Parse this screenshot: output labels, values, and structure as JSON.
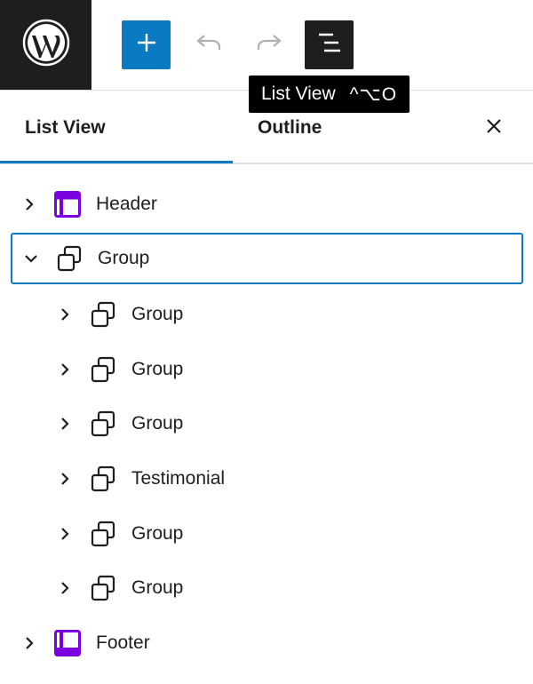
{
  "toolbar": {
    "logo_icon": "wordpress-logo-icon",
    "add_icon": "plus-icon",
    "undo_icon": "undo-icon",
    "redo_icon": "redo-icon",
    "listview_icon": "list-view-icon",
    "accent_color": "#0a7bc2"
  },
  "tooltip": {
    "label": "List View",
    "shortcut": "^⌥O"
  },
  "tabs": [
    {
      "label": "List View",
      "active": true
    },
    {
      "label": "Outline",
      "active": false
    }
  ],
  "close_icon": "close-icon",
  "tree": {
    "items": [
      {
        "label": "Header",
        "icon": "template-part-header-icon",
        "expanded": false,
        "level": 1
      },
      {
        "label": "Group",
        "icon": "group-icon",
        "expanded": true,
        "level": 1,
        "selected": true
      },
      {
        "label": "Group",
        "icon": "group-icon",
        "expanded": false,
        "level": 2
      },
      {
        "label": "Group",
        "icon": "group-icon",
        "expanded": false,
        "level": 2
      },
      {
        "label": "Group",
        "icon": "group-icon",
        "expanded": false,
        "level": 2
      },
      {
        "label": "Testimonial",
        "icon": "group-icon",
        "expanded": false,
        "level": 2
      },
      {
        "label": "Group",
        "icon": "group-icon",
        "expanded": false,
        "level": 2
      },
      {
        "label": "Group",
        "icon": "group-icon",
        "expanded": false,
        "level": 2
      },
      {
        "label": "Footer",
        "icon": "template-part-footer-icon",
        "expanded": false,
        "level": 1
      }
    ],
    "template_part_color": "#7a00df"
  }
}
